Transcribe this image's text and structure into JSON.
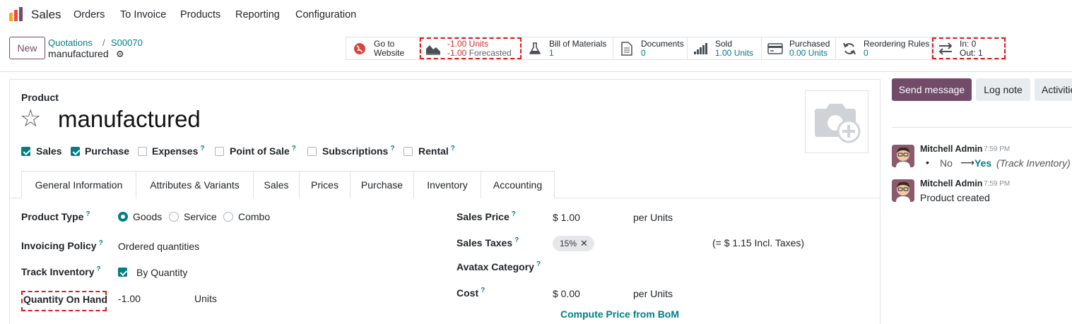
{
  "nav": {
    "app_name": "Sales",
    "items": [
      "Orders",
      "To Invoice",
      "Products",
      "Reporting",
      "Configuration"
    ]
  },
  "control": {
    "new_label": "New",
    "breadcrumb": [
      "Quotations",
      "S00070"
    ],
    "current": "manufactured"
  },
  "smart_buttons": {
    "website": {
      "l1": "Go to",
      "l2": "Website"
    },
    "forecast": {
      "l1": "-1.00 Units",
      "l2": "-1.00",
      "l2b": "Forecasted"
    },
    "bom": {
      "l1": "Bill of Materials",
      "l2": "1"
    },
    "documents": {
      "l1": "Documents",
      "l2": "0"
    },
    "sold": {
      "l1": "Sold",
      "l2": "1.00 Units"
    },
    "purchased": {
      "l1": "Purchased",
      "l2": "0.00 Units"
    },
    "reorder": {
      "l1": "Reordering Rules",
      "l2": "0"
    },
    "inout": {
      "l1": "In: 0",
      "l2": "Out: 1"
    }
  },
  "form": {
    "product_label": "Product",
    "name": "manufactured",
    "checks": [
      {
        "label": "Sales",
        "checked": true
      },
      {
        "label": "Purchase",
        "checked": true
      },
      {
        "label": "Expenses",
        "checked": false
      },
      {
        "label": "Point of Sale",
        "checked": false
      },
      {
        "label": "Subscriptions",
        "checked": false
      },
      {
        "label": "Rental",
        "checked": false
      }
    ],
    "tabs": [
      "General Information",
      "Attributes & Variants",
      "Sales",
      "Prices",
      "Purchase",
      "Inventory",
      "Accounting"
    ],
    "left": {
      "product_type_label": "Product Type",
      "types": [
        "Goods",
        "Service",
        "Combo"
      ],
      "invoicing_label": "Invoicing Policy",
      "invoicing_value": "Ordered quantities",
      "track_label": "Track Inventory",
      "track_value": "By Quantity",
      "qoh_label": "Quantity On Hand",
      "qoh_value": "-1.00",
      "qoh_unit": "Units"
    },
    "right": {
      "sales_price_label": "Sales Price",
      "sales_price_value": "$ 1.00",
      "sales_price_unit": "per Units",
      "sales_taxes_label": "Sales Taxes",
      "tax_chip": "15%",
      "incl_taxes": "(= $ 1.15 Incl. Taxes)",
      "avatax_label": "Avatax Category",
      "cost_label": "Cost",
      "cost_value": "$ 0.00",
      "cost_unit": "per Units",
      "compute_label": "Compute Price from BoM"
    }
  },
  "chatter": {
    "send": "Send message",
    "log": "Log note",
    "activities": "Activities",
    "messages": [
      {
        "author": "Mitchell Admin",
        "time": "7:59 PM",
        "old": "No",
        "new": "Yes",
        "field": "(Track Inventory)"
      },
      {
        "author": "Mitchell Admin",
        "time": "7:59 PM",
        "body": "Product created"
      }
    ]
  }
}
